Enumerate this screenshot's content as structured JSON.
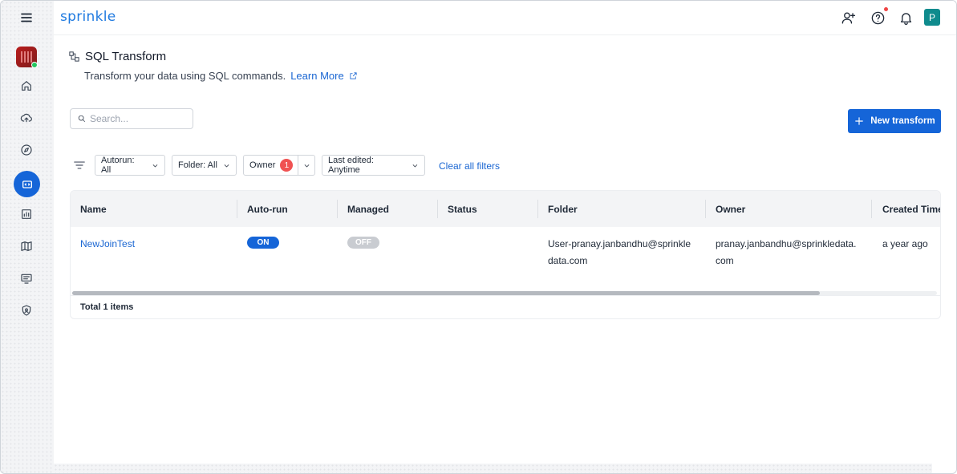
{
  "brand": "sprinkle",
  "user_initial": "P",
  "page": {
    "title": "SQL Transform",
    "subtitle": "Transform your data using SQL commands.",
    "learn_more": "Learn More"
  },
  "search": {
    "placeholder": "Search...",
    "value": ""
  },
  "new_button": "New transform",
  "filters": {
    "autorun": "Autorun: All",
    "folder": "Folder: All",
    "owner": "Owner",
    "owner_count": "1",
    "last_edited": "Last edited: Anytime",
    "clear_all": "Clear all filters"
  },
  "table": {
    "columns": [
      "Name",
      "Auto-run",
      "Managed",
      "Status",
      "Folder",
      "Owner",
      "Created Time"
    ],
    "rows": [
      {
        "name": "NewJoinTest",
        "autorun": "ON",
        "managed": "OFF",
        "status": "",
        "folder_line1": "User-pranay.janbandhu@sprinkle",
        "folder_line2": "data.com",
        "owner_line1": "pranay.janbandhu@sprinkledata.",
        "owner_line2": "com",
        "created": "a year ago"
      }
    ],
    "total": "Total 1 items"
  },
  "colors": {
    "primary": "#1565d8",
    "link": "#1a66d2",
    "badge_red": "#f05252",
    "user_badge": "#0f8b8d"
  },
  "icons": {
    "sidebar": [
      "menu-icon",
      "home-icon",
      "cloud-upload-icon",
      "compass-icon",
      "transform-icon",
      "chart-icon",
      "map-icon",
      "notes-icon",
      "shield-icon"
    ],
    "topbar": [
      "add-user-icon",
      "help-icon",
      "bell-icon"
    ]
  }
}
